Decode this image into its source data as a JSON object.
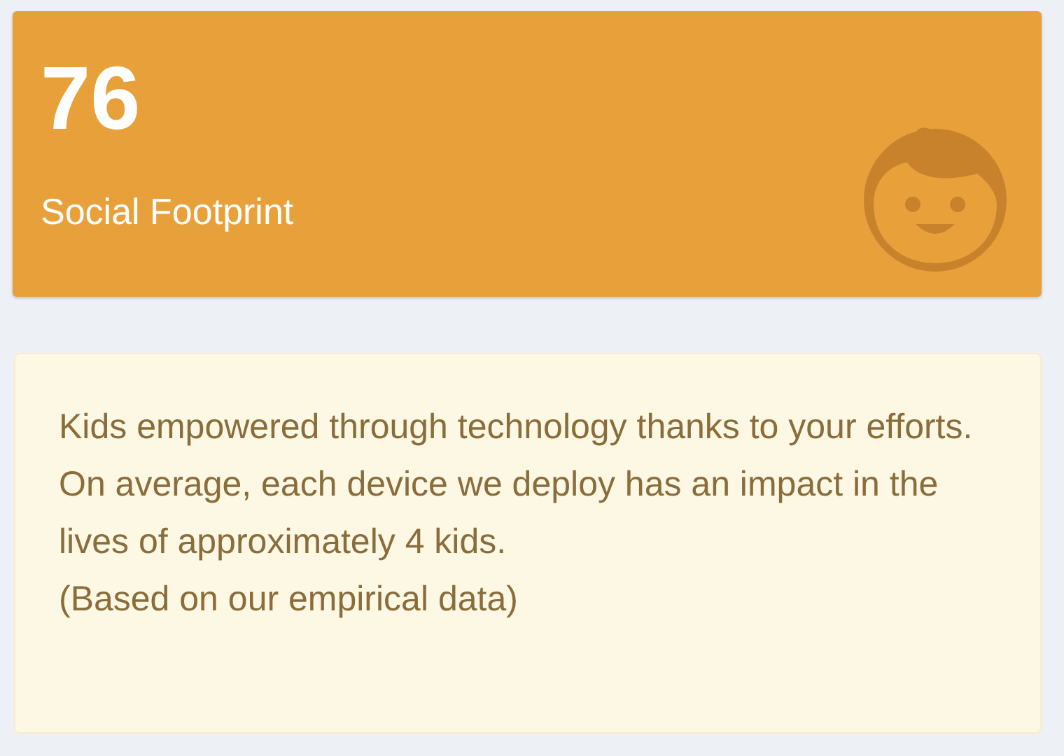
{
  "stat_card": {
    "value": "76",
    "label": "Social Footprint"
  },
  "info_box": {
    "paragraphs": [
      "Kids empowered through technology thanks to your efforts.",
      "On average, each device we deploy has an impact in the lives of approximately 4 kids.",
      "(Based on our empirical data)"
    ]
  }
}
